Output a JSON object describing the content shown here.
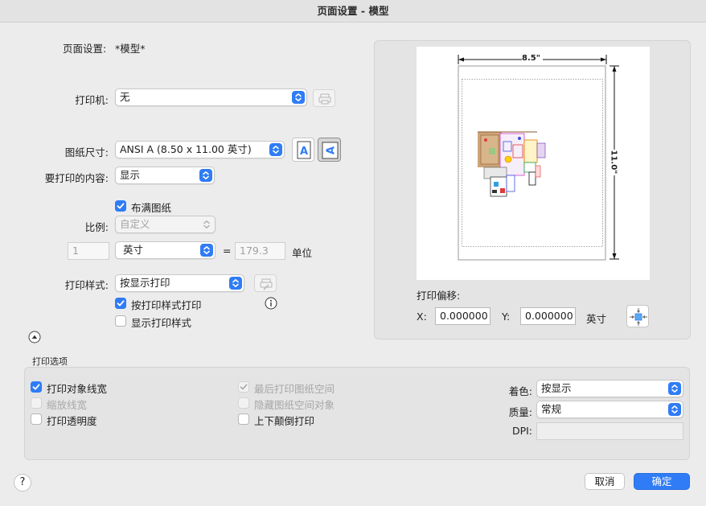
{
  "window": {
    "title": "页面设置 - 模型"
  },
  "page_setup": {
    "label": "页面设置:",
    "value": "*模型*"
  },
  "printer": {
    "label": "打印机:",
    "value": "无"
  },
  "paper_size": {
    "label": "图纸尺寸:",
    "value": "ANSI A (8.50 x 11.00 英寸)"
  },
  "print_what": {
    "label": "要打印的内容:",
    "value": "显示"
  },
  "fit_to_paper": {
    "label": "布满图纸",
    "checked": true
  },
  "scale": {
    "label": "比例:",
    "value": "自定义",
    "disabled": true
  },
  "scale_value": {
    "value": "1",
    "unit": "英寸",
    "equals": "=",
    "drawing_units": "179.3",
    "units_label": "单位"
  },
  "plot_style": {
    "label": "打印样式:",
    "value": "按显示打印"
  },
  "plot_with_styles": {
    "label": "按打印样式打印",
    "checked": true
  },
  "display_plot_styles": {
    "label": "显示打印样式",
    "checked": false
  },
  "preview": {
    "width_dim": "8.5\"",
    "height_dim": "11.0\""
  },
  "offset": {
    "label": "打印偏移:",
    "x_label": "X:",
    "x_value": "0.000000",
    "y_label": "Y:",
    "y_value": "0.000000",
    "unit": "英寸"
  },
  "plot_options": {
    "title": "打印选项",
    "items": [
      {
        "label": "打印对象线宽",
        "checked": true,
        "disabled": false
      },
      {
        "label": "缩放线宽",
        "checked": false,
        "disabled": true
      },
      {
        "label": "打印透明度",
        "checked": false,
        "disabled": false
      },
      {
        "label": "最后打印图纸空间",
        "checked": true,
        "disabled": true
      },
      {
        "label": "隐藏图纸空间对象",
        "checked": false,
        "disabled": true
      },
      {
        "label": "上下颠倒打印",
        "checked": false,
        "disabled": false
      }
    ],
    "shade": {
      "label": "着色:",
      "value": "按显示"
    },
    "quality": {
      "label": "质量:",
      "value": "常规"
    },
    "dpi": {
      "label": "DPI:",
      "value": ""
    }
  },
  "footer": {
    "help": "?",
    "cancel": "取消",
    "ok": "确定"
  },
  "colors": {
    "accent": "#2f7cf6"
  }
}
